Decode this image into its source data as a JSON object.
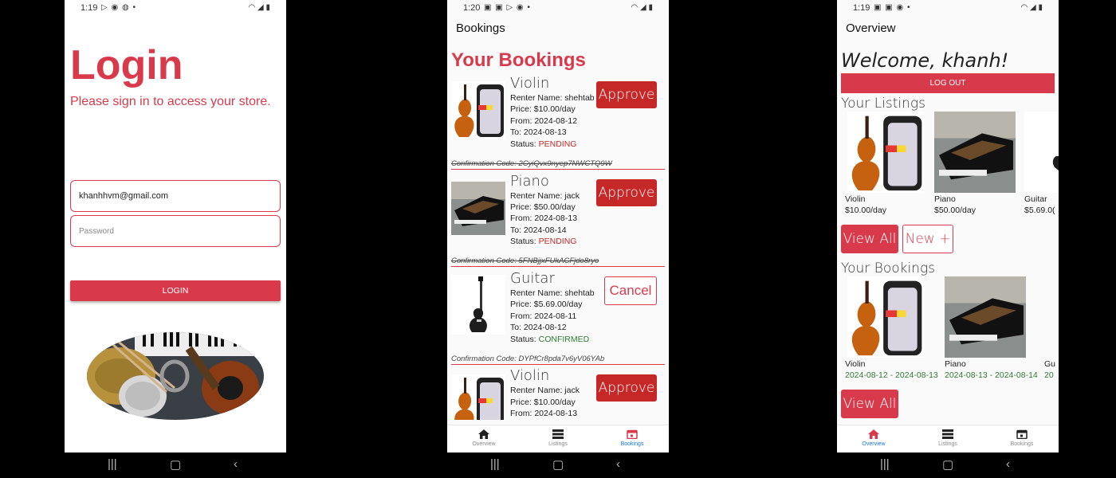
{
  "login_screen": {
    "status_time": "1:19",
    "title": "Login",
    "subtitle": "Please sign in to access your store.",
    "email_value": "khanhhvm@gmail.com",
    "password_placeholder": "Password",
    "login_button": "LOGIN"
  },
  "bookings_screen": {
    "status_time": "1:20",
    "header": "Bookings",
    "page_title": "Your Bookings",
    "bookings": [
      {
        "title": "Violin",
        "renter": "Renter Name: shehtab",
        "price": "Price: $10.00/day",
        "from": "From: 2024-08-12",
        "to": "To: 2024-08-13",
        "status_label": "Status: ",
        "status": "PENDING",
        "action": "Approve",
        "confirmation": "Confirmation Code: 2CyiQvx9nyep7NWCTQ9W"
      },
      {
        "title": "Piano",
        "renter": "Renter Name: jack",
        "price": "Price: $50.00/day",
        "from": "From: 2024-08-13",
        "to": "To: 2024-08-14",
        "status_label": "Status: ",
        "status": "PENDING",
        "action": "Approve",
        "confirmation": "Confirmation Code: 5FNBjjxFUkACFjdo8ryo"
      },
      {
        "title": "Guitar",
        "renter": "Renter Name: shehtab",
        "price": "Price: $5.69.00/day",
        "from": "From: 2024-08-11",
        "to": "To: 2024-08-12",
        "status_label": "Status: ",
        "status": "CONFIRMED",
        "action": "Cancel",
        "confirmation": "Confirmation Code: DYPfCr8pda7v6yV06YAb"
      },
      {
        "title": "Violin",
        "renter": "Renter Name: jack",
        "price": "Price: $10.00/day",
        "from": "From: 2024-08-13",
        "action": "Approve"
      }
    ]
  },
  "overview_screen": {
    "status_time": "1:19",
    "header": "Overview",
    "welcome": "Welcome, khanh!",
    "logout": "LOG OUT",
    "listings_title": "Your Listings",
    "listings": [
      {
        "name": "Violin",
        "price": "$10.00/day"
      },
      {
        "name": "Piano",
        "price": "$50.00/day"
      },
      {
        "name": "Guitar",
        "price": "$5.69.0("
      }
    ],
    "view_all": "View All",
    "new_button": "New +",
    "bookings_title": "Your Bookings",
    "bookings": [
      {
        "name": "Violin",
        "dates": "2024-08-12 - 2024-08-13"
      },
      {
        "name": "Piano",
        "dates": "2024-08-13 - 2024-08-14"
      },
      {
        "name": "Gu",
        "dates": "20"
      }
    ],
    "view_all_bookings": "View All"
  },
  "tabs": {
    "overview": "Overview",
    "listings": "Listings",
    "bookings": "Bookings"
  },
  "colors": {
    "brand_red": "#d93a4b",
    "approve_red": "#c62828",
    "confirmed_green": "#2e7d32",
    "pending_red": "#c62828",
    "active_tab": "#1976d2"
  }
}
